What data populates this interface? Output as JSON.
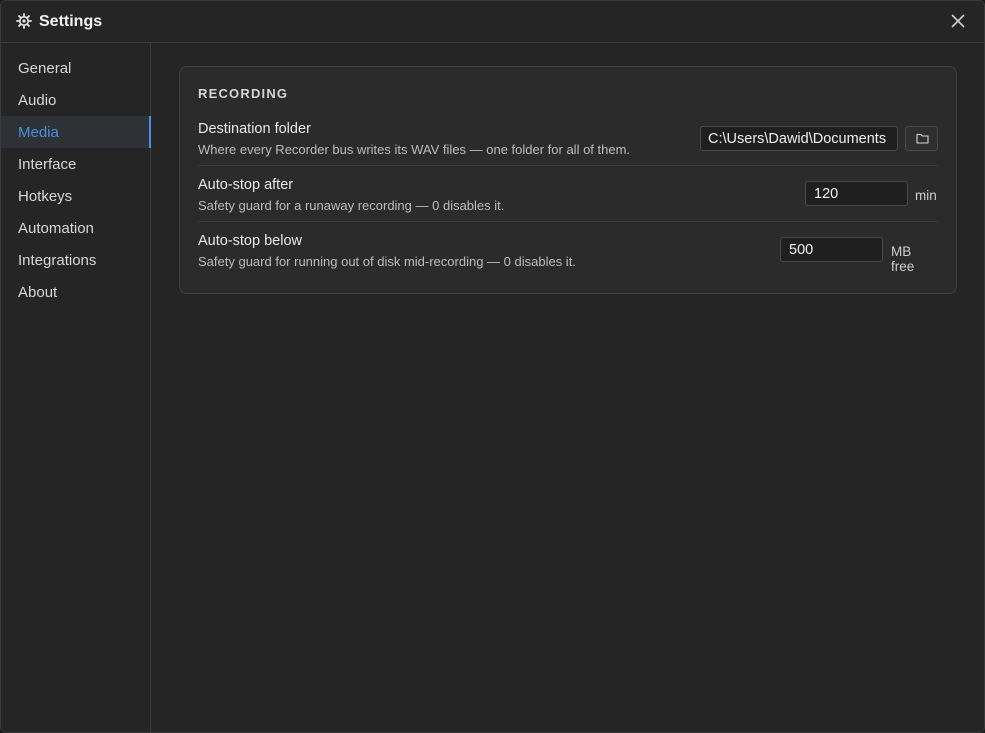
{
  "window": {
    "title": "Settings",
    "title_icon": "gear-icon",
    "close_icon": "close-icon"
  },
  "sidebar": {
    "items": [
      {
        "label": "General",
        "active": false
      },
      {
        "label": "Audio",
        "active": false
      },
      {
        "label": "Media",
        "active": true
      },
      {
        "label": "Interface",
        "active": false
      },
      {
        "label": "Hotkeys",
        "active": false
      },
      {
        "label": "Automation",
        "active": false
      },
      {
        "label": "Integrations",
        "active": false
      },
      {
        "label": "About",
        "active": false
      }
    ]
  },
  "recording": {
    "section_title": "RECORDING",
    "destination": {
      "label": "Destination folder",
      "description": "Where every Recorder bus writes its WAV files — one folder for all of them.",
      "value": "C:\\Users\\Dawid\\Documents",
      "browse_icon": "folder-icon"
    },
    "autostop_after": {
      "label": "Auto-stop after",
      "description": "Safety guard for a runaway recording — 0 disables it.",
      "value": "120",
      "unit": "min"
    },
    "autostop_below": {
      "label": "Auto-stop below",
      "description": "Safety guard for running out of disk mid-recording — 0 disables it.",
      "value": "500",
      "unit": "MB free"
    }
  },
  "colors": {
    "accent": "#4a90e2",
    "background": "#252525",
    "card": "#2b2b2b"
  }
}
